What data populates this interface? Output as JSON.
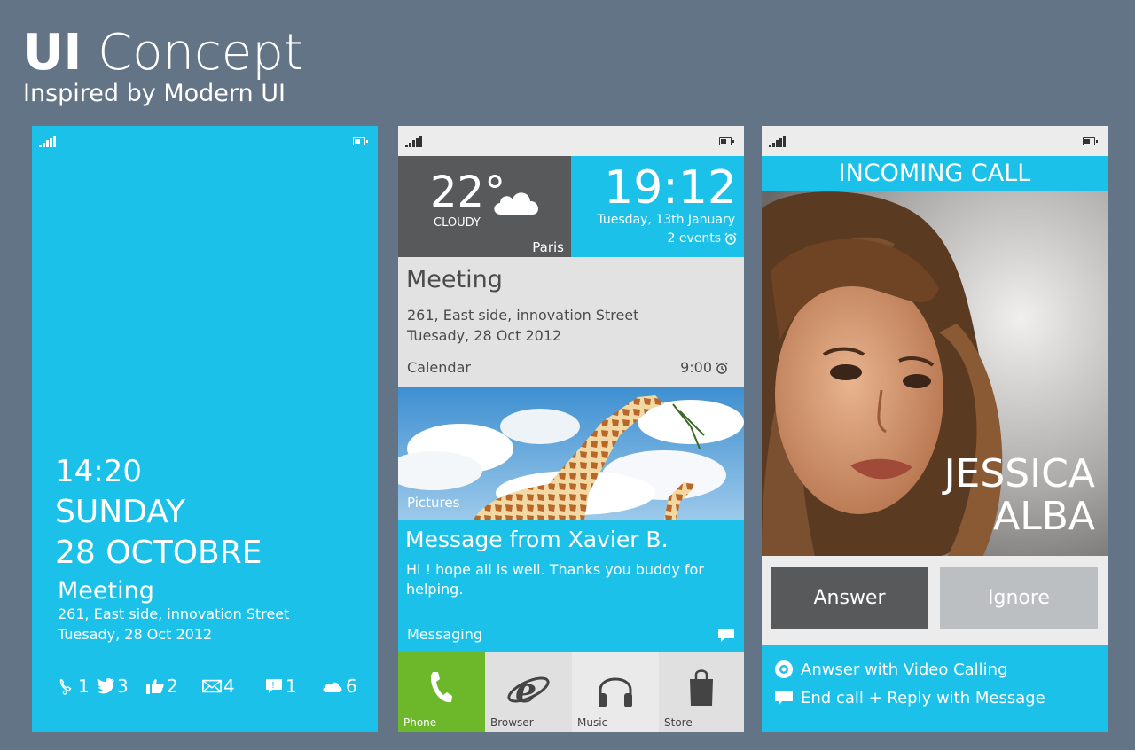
{
  "header": {
    "title_bold": "UI",
    "title_rest": "Concept",
    "subtitle": "Inspired by Modern UI"
  },
  "colors": {
    "background": "#647487",
    "accent": "#1bc1e8",
    "tile_dark": "#57595a",
    "phone_green": "#6cb82a",
    "light_gray": "#ececec"
  },
  "lock_screen": {
    "time": "14:20",
    "day": "SUNDAY",
    "date": "28 OCTOBRE",
    "event_title": "Meeting",
    "event_address": "261, East side, innovation Street",
    "event_date": "Tuesady, 28 Oct 2012",
    "notifications": [
      {
        "icon": "missed-call-icon",
        "count": "1"
      },
      {
        "icon": "twitter-icon",
        "count": "3"
      },
      {
        "icon": "like-icon",
        "count": "2"
      },
      {
        "icon": "mail-icon",
        "count": "4"
      },
      {
        "icon": "chat-icon",
        "count": "1"
      },
      {
        "icon": "cloud-icon",
        "count": "6"
      }
    ]
  },
  "home_screen": {
    "weather": {
      "temp": "22°",
      "condition": "CLOUDY",
      "city": "Paris",
      "icon": "cloud-icon"
    },
    "clock": {
      "time": "19:12",
      "date": "Tuesday, 13th January",
      "events": "2 events",
      "icon": "alarm-icon"
    },
    "meeting": {
      "title": "Meeting",
      "address": "261, East side, innovation Street",
      "date": "Tuesady, 28 Oct 2012",
      "app": "Calendar",
      "time": "9:00"
    },
    "pictures_label": "Pictures",
    "message": {
      "title": "Message from Xavier B.",
      "body": "Hi ! hope all is well. Thanks  you buddy for helping.",
      "app": "Messaging"
    },
    "apps": [
      {
        "label": "Phone",
        "icon": "phone-icon"
      },
      {
        "label": "Browser",
        "icon": "browser-icon"
      },
      {
        "label": "Music",
        "icon": "headphones-icon"
      },
      {
        "label": "Store",
        "icon": "shopping-bag-icon"
      }
    ]
  },
  "call_screen": {
    "header": "INCOMING CALL",
    "caller_first": "JESSICA",
    "caller_last": "ALBA",
    "answer": "Answer",
    "ignore": "Ignore",
    "option_video": "Anwser with Video Calling",
    "option_reply": "End call + Reply with Message"
  }
}
